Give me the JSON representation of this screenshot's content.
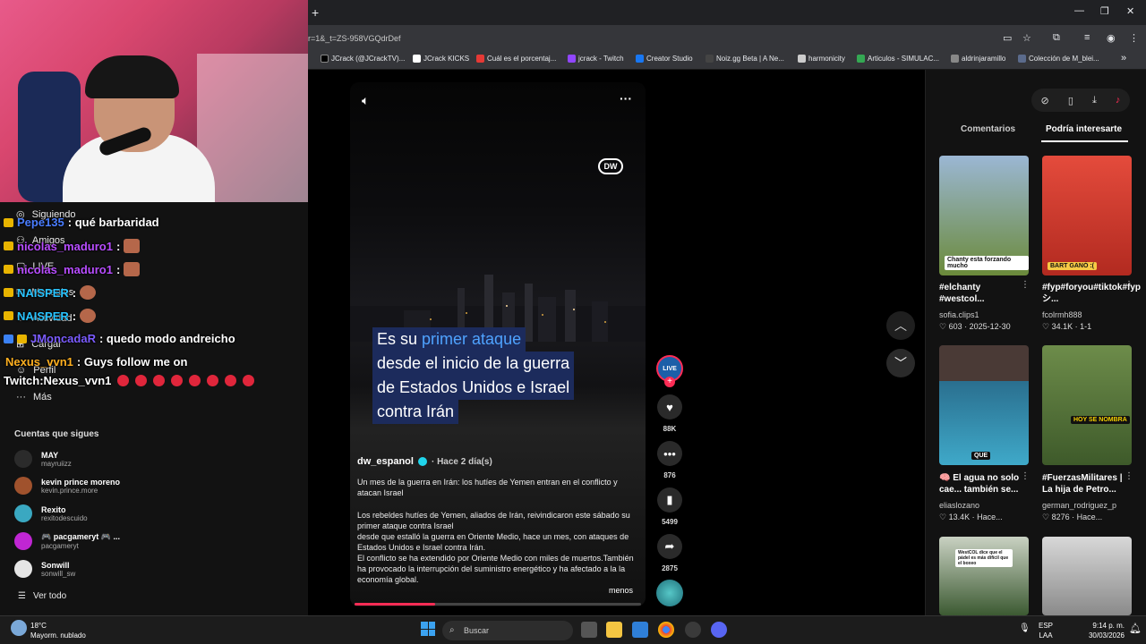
{
  "browser": {
    "new_tab": "+",
    "address": "r=1&_t=ZS-958VGQdrDef",
    "window_controls": [
      "—",
      "❐",
      "✕"
    ],
    "bookmarks": [
      {
        "label": "JCrack (@JCrackTV)...",
        "color": "#000000"
      },
      {
        "label": "JCrack KICKS",
        "color": "#ffffff"
      },
      {
        "label": "Cuál es el porcentaj...",
        "color": "#e53935"
      },
      {
        "label": "jcrack - Twitch",
        "color": "#9146ff"
      },
      {
        "label": "Creator Studio",
        "color": "#1877f2"
      },
      {
        "label": "Noiz.gg Beta | A Ne...",
        "color": "#444444"
      },
      {
        "label": "harmonicity",
        "color": "#cccccc"
      },
      {
        "label": "Articulos - SIMULAC...",
        "color": "#34a853"
      },
      {
        "label": "aldrinjaramillo",
        "color": "#888888"
      },
      {
        "label": "Colección de M_blei...",
        "color": "#5b6b8c"
      }
    ],
    "bookmark_more": "»"
  },
  "sidebar": {
    "nav": [
      {
        "label": "Siguiendo",
        "icon": "following-icon"
      },
      {
        "label": "Amigos",
        "icon": "friends-icon"
      },
      {
        "label": "LIVE",
        "icon": "live-icon"
      },
      {
        "label": "Mensajes",
        "icon": "messages-icon"
      },
      {
        "label": "Actividad",
        "icon": "activity-icon"
      },
      {
        "label": "Cargar",
        "icon": "upload-icon"
      },
      {
        "label": "Perfil",
        "icon": "profile-icon"
      },
      {
        "label": "Más",
        "icon": "more-icon"
      }
    ],
    "following_title": "Cuentas que sigues",
    "accounts": [
      {
        "name": "MAY",
        "handle": "mayruiizz",
        "color": "#2b2b2b"
      },
      {
        "name": "kevin prince moreno",
        "handle": "kevin.prince.more",
        "color": "#a0522d"
      },
      {
        "name": "Rexito",
        "handle": "rexitodescuido",
        "color": "#3aa8c1"
      },
      {
        "name": "🎮 pacgameryt 🎮 ...",
        "handle": "pacgameryt",
        "color": "#c026d3"
      },
      {
        "name": "Sonwill",
        "handle": "sonwill_sw",
        "color": "#e5e5e5"
      }
    ],
    "see_all": "Ver todo"
  },
  "chat": [
    {
      "user": "Pepe135",
      "text": ": qué barbaridad",
      "color": "#4a7dff",
      "emote": false
    },
    {
      "user": "nicolas_maduro1",
      "text": ":",
      "color": "#b84dff",
      "emote": true
    },
    {
      "user": "nicolas_maduro1",
      "text": ":",
      "color": "#b84dff",
      "emote": true
    },
    {
      "user": "NAISPER",
      "text": ":",
      "color": "#29c4ff",
      "emote": true
    },
    {
      "user": "NAISPER",
      "text": ":",
      "color": "#29c4ff",
      "emote": true
    },
    {
      "user": "JMoncadaR",
      "text": ": quedo modo andreicho",
      "color": "#7b5cff",
      "emote": false
    },
    {
      "user": "Nexus_vvn1",
      "text": ": Guys follow me on",
      "color": "#ffb020",
      "emote": false
    },
    {
      "user": "",
      "text": "Twitch:Nexus_vvn1",
      "color": "#ffffff",
      "emote": false
    }
  ],
  "video": {
    "caption": {
      "line1_pre": "Es su ",
      "line1_hl": "primer ataque",
      "line2": "desde el inicio de la guerra",
      "line3": "de Estados Unidos e Israel",
      "line4": "contra Irán"
    },
    "logo": "DW",
    "author": "dw_espanol",
    "time": "· Hace 2 día(s)",
    "title": "Un mes de la guerra en Irán: los hutíes de Yemen entran en el conflicto y atacan Israel",
    "body1": "Los rebeldes hutíes de Yemen, aliados de Irán, reivindicaron este sábado su primer ataque contra Israel",
    "body2": "desde que estalló la guerra en Oriente Medio, hace un mes, con ataques de Estados Unidos e Israel contra Irán.",
    "body3": "El conflicto se ha extendido por Oriente Medio con miles de muertos.También ha provocado la interrupción del suministro energético y ha afectado a la la economía global.",
    "less": "menos",
    "progress": 0.28
  },
  "actions": {
    "live": "LIVE",
    "likes": "88K",
    "comments": "876",
    "saves": "5499",
    "shares": "2875"
  },
  "right_panel": {
    "tabs": [
      "Comentarios",
      "Podría interesarte"
    ],
    "items": [
      {
        "title": "#elchanty #westcol...",
        "user": "sofia.clips1",
        "stats": "♡ 603 · 2025-12-30",
        "thumb_label": "Chanty esta forzando mucho",
        "thumb_color": "#6b8a3a"
      },
      {
        "title": "#fyp#foryou#tiktok#fyp シ...",
        "user": "fcolrmh888",
        "stats": "♡ 34.1K · 1-1",
        "thumb_label": "BART GANÓ :(",
        "thumb_color": "#c0392b"
      },
      {
        "title": "🧠 El agua no solo cae... también se...",
        "user": "eliaslozano",
        "stats": "♡ 13.4K · Hace...",
        "thumb_label": "QUE",
        "thumb_color": "#2a6f8f"
      },
      {
        "title": "#FuerzasMilitares | La hija de Petro...",
        "user": "german_rodriguez_p",
        "stats": "♡ 8276 · Hace...",
        "thumb_label": "HOY SE NOMBRA",
        "thumb_color": "#4c6b3a"
      },
      {
        "title": "",
        "user": "",
        "stats": "",
        "thumb_label": "WestCOL dice que el pádel es más difícil que el boxeo",
        "thumb_color": "#3c5a32"
      },
      {
        "title": "",
        "user": "",
        "stats": "",
        "thumb_label": "",
        "thumb_color": "#9a9a9a"
      }
    ]
  },
  "taskbar": {
    "temp": "18°C",
    "weather": "Mayorm. nublado",
    "search": "Buscar",
    "lang1": "ESP",
    "lang2": "LAA",
    "time": "9:14 p. m.",
    "date": "30/03/2026"
  }
}
